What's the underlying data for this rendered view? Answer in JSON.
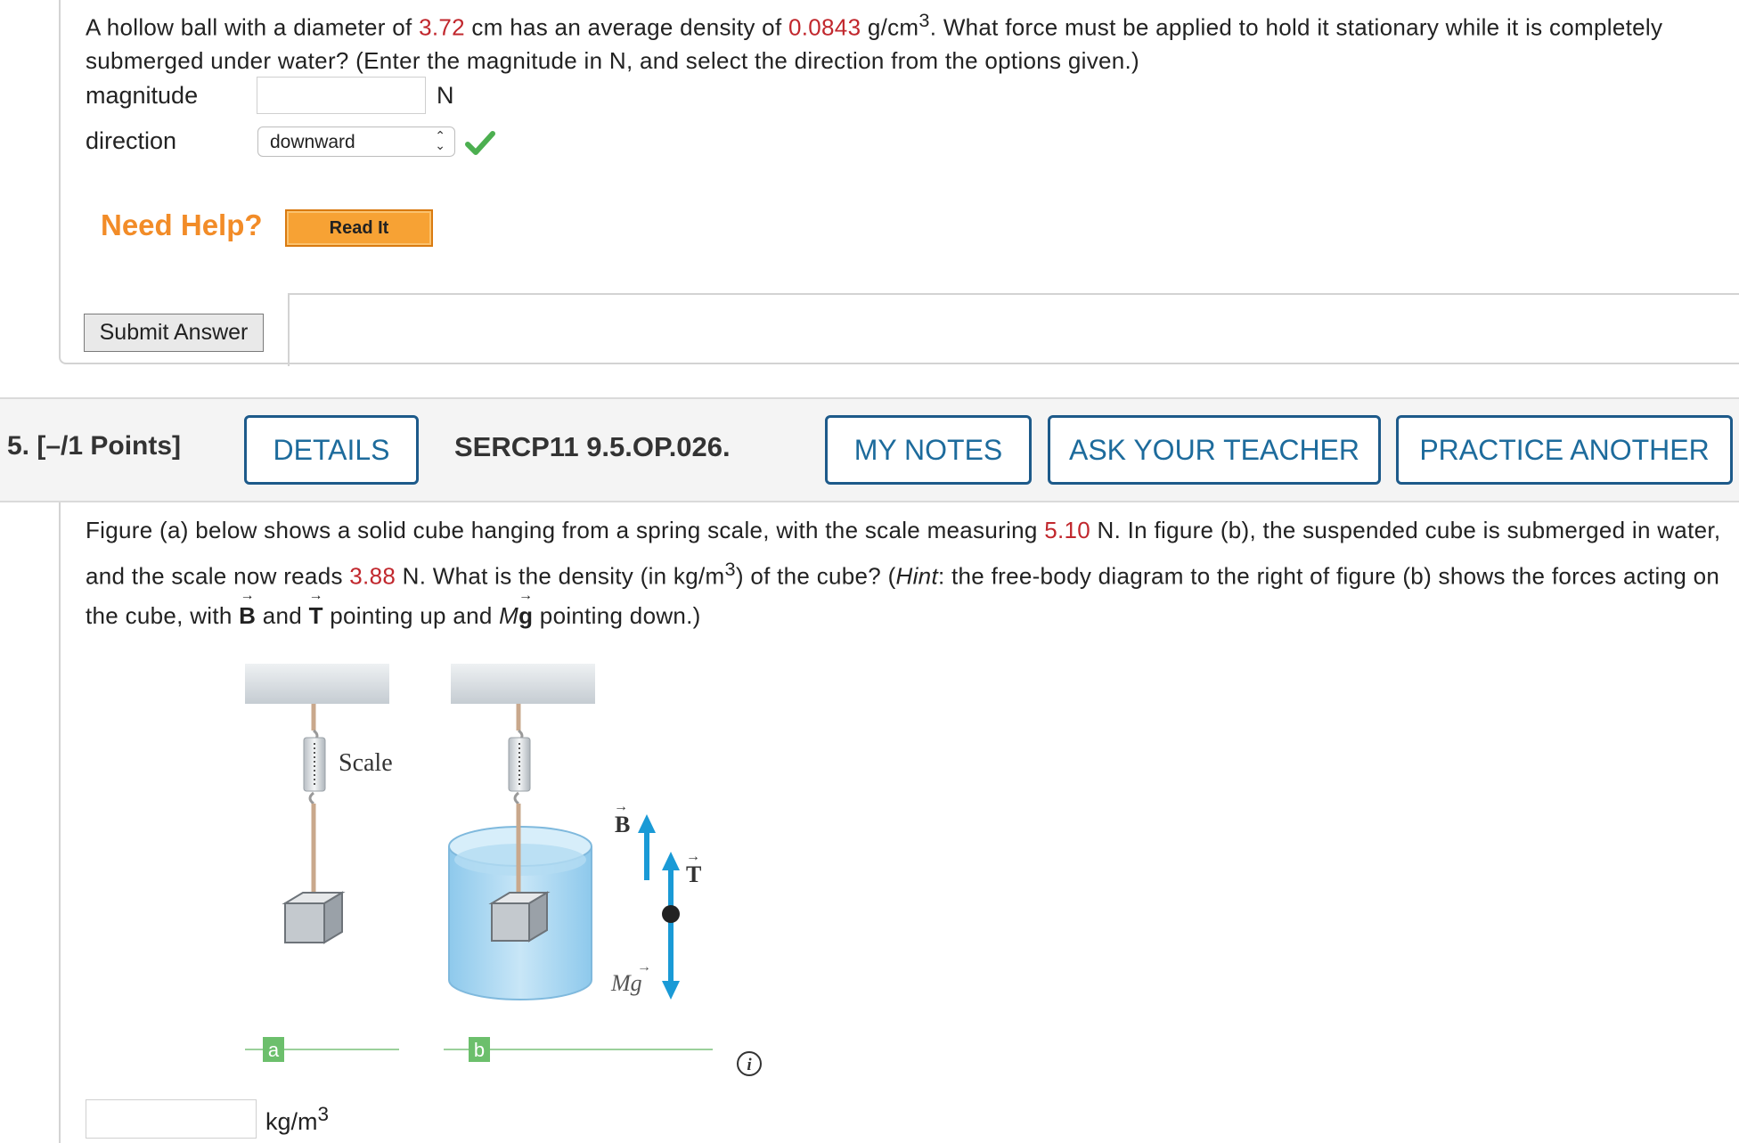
{
  "q4": {
    "text_1": "A hollow ball with a diameter of ",
    "diameter": "3.72",
    "text_2": " cm has an average density of ",
    "density": "0.0843",
    "text_3": " g/cm",
    "sup": "3",
    "text_4": ". What force must be applied to hold it stationary while it is completely submerged under water? (Enter the magnitude in N, and select the direction from the options given.)",
    "magnitude_label": "magnitude",
    "magnitude_value": "",
    "magnitude_unit": "N",
    "direction_label": "direction",
    "direction_value": "downward",
    "need_help": "Need Help?",
    "read_it": "Read It",
    "submit": "Submit Answer"
  },
  "q5": {
    "number": "5.  [–/1 Points]",
    "details": "DETAILS",
    "code": "SERCP11 9.5.OP.026.",
    "my_notes": "MY NOTES",
    "ask_teacher": "ASK YOUR TEACHER",
    "practice": "PRACTICE ANOTHER",
    "t1": "Figure (a) below shows a solid cube hanging from a spring scale, with the scale measuring ",
    "scale_a": "5.10",
    "t2": " N. In figure (b), the suspended cube is submerged in water, and the scale now reads ",
    "scale_b": "3.88",
    "t3": " N. What is the density (in kg/m",
    "sup": "3",
    "t4": ") of the cube? (",
    "hint": "Hint",
    "t5": ": the free-body diagram to the right of figure (b) shows the forces acting on the cube, with ",
    "vec_b": "B",
    "t6": " and ",
    "vec_t": "T",
    "t7": " pointing up and ",
    "vec_m": "M",
    "vec_g": "g",
    "t8": " pointing down.)",
    "figure": {
      "scale_label": "Scale",
      "label_a": "a",
      "label_b": "b",
      "force_b": "B",
      "force_t": "T",
      "force_mg": "Mg"
    },
    "answer_value": "",
    "answer_unit": "kg/m",
    "answer_sup": "3"
  },
  "colors": {
    "given_value": "#c1272d",
    "button_blue": "#1d6b9c",
    "help_orange": "#f28c28",
    "arrow_blue": "#1a9ad6",
    "check_green": "#4caf50"
  },
  "icons": [
    "check-icon",
    "info-icon",
    "select-chevron-icon"
  ]
}
